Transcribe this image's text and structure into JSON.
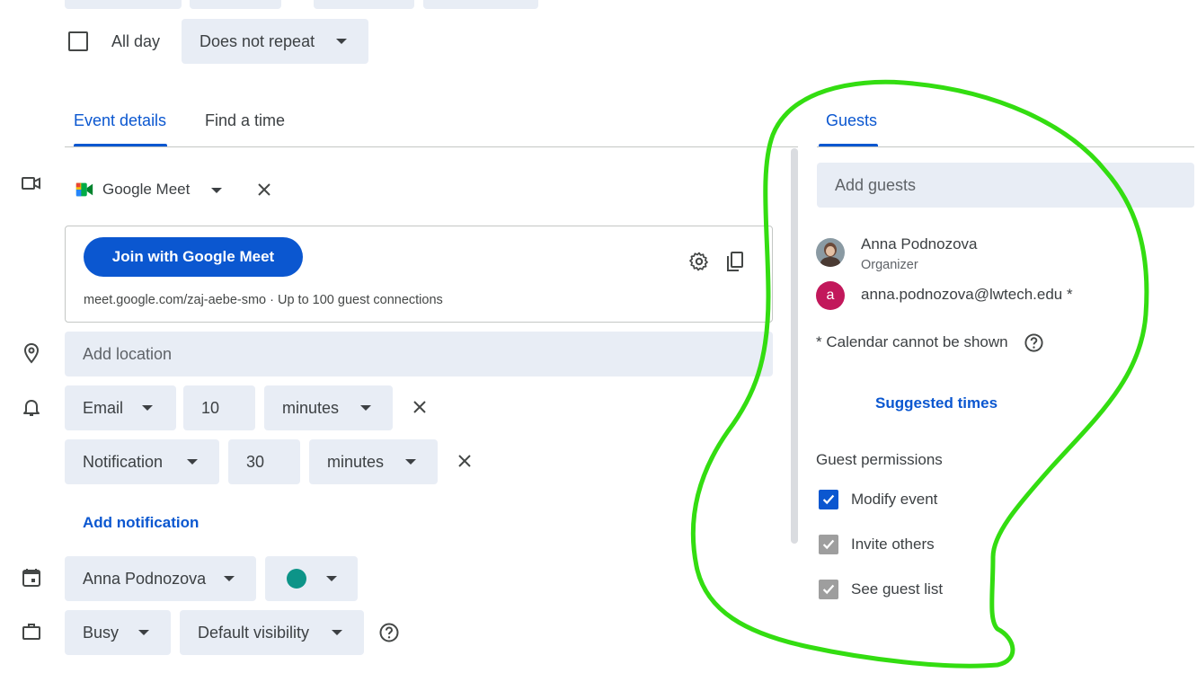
{
  "top": {
    "all_day_label": "All day",
    "repeat_value": "Does not repeat"
  },
  "tabs": {
    "event_details": "Event details",
    "find_a_time": "Find a time",
    "guests": "Guests"
  },
  "conference": {
    "provider": "Google Meet",
    "join_button": "Join with Google Meet",
    "link_info": "meet.google.com/zaj-aebe-smo · Up to 100 guest connections"
  },
  "location": {
    "placeholder": "Add location"
  },
  "notifications": [
    {
      "method": "Email",
      "amount": "10",
      "unit": "minutes"
    },
    {
      "method": "Notification",
      "amount": "30",
      "unit": "minutes"
    }
  ],
  "add_notification": "Add notification",
  "calendar": {
    "owner": "Anna Podnozova",
    "color": "#0d9488"
  },
  "availability": {
    "status": "Busy",
    "visibility": "Default visibility"
  },
  "guests": {
    "add_placeholder": "Add guests",
    "list": [
      {
        "name": "Anna Podnozova",
        "role": "Organizer"
      },
      {
        "name": "anna.podnozova@lwtech.edu *",
        "avatar_letter": "a",
        "avatar_color": "#c2185b"
      }
    ],
    "calendar_note": "* Calendar cannot be shown",
    "suggested_times": "Suggested times",
    "permissions_title": "Guest permissions",
    "permissions": [
      {
        "label": "Modify event",
        "checked": true
      },
      {
        "label": "Invite others",
        "checked": true
      },
      {
        "label": "See guest list",
        "checked": true
      }
    ]
  },
  "annotation_color": "#33dd11"
}
